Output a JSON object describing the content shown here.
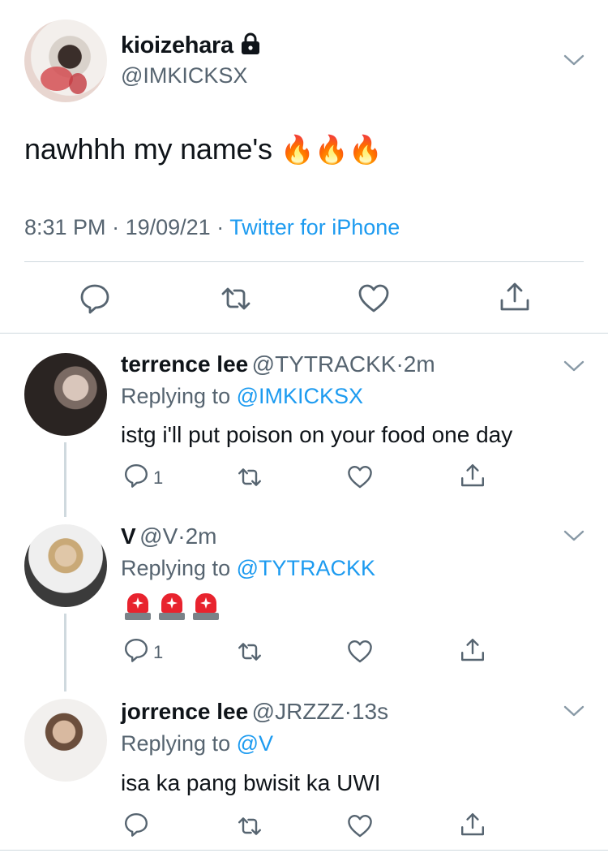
{
  "main_tweet": {
    "display_name": "kioizehara",
    "handle": "@IMKICKSX",
    "text": "nawhhh my name's",
    "emoji": "🔥🔥🔥",
    "time": "8:31 PM",
    "date": "19/09/21",
    "source": "Twitter for iPhone",
    "separator": "·"
  },
  "replies": [
    {
      "display_name": "terrence lee",
      "handle": "@TYTRACKK",
      "age": "2m",
      "replying_prefix": "Replying to",
      "replying_to": "@IMKICKSX",
      "text": "istg i'll put poison on your food one day",
      "reply_count": "1"
    },
    {
      "display_name": "V",
      "handle": "@V",
      "age": "2m",
      "replying_prefix": "Replying to",
      "replying_to": "@TYTRACKK",
      "text": "🚨🚨🚨",
      "reply_count": "1"
    },
    {
      "display_name": "jorrence lee",
      "handle": "@JRZZZ",
      "age": "13s",
      "replying_prefix": "Replying to",
      "replying_to": "@V",
      "text": "isa ka pang bwisit ka UWI",
      "reply_count": ""
    }
  ],
  "icons": [
    "lock-icon",
    "chevron-down-icon",
    "reply-icon",
    "retweet-icon",
    "like-icon",
    "share-icon"
  ],
  "colors": {
    "link": "#1d9bf0",
    "secondary_text": "#566470",
    "divider": "#cfd9de"
  }
}
